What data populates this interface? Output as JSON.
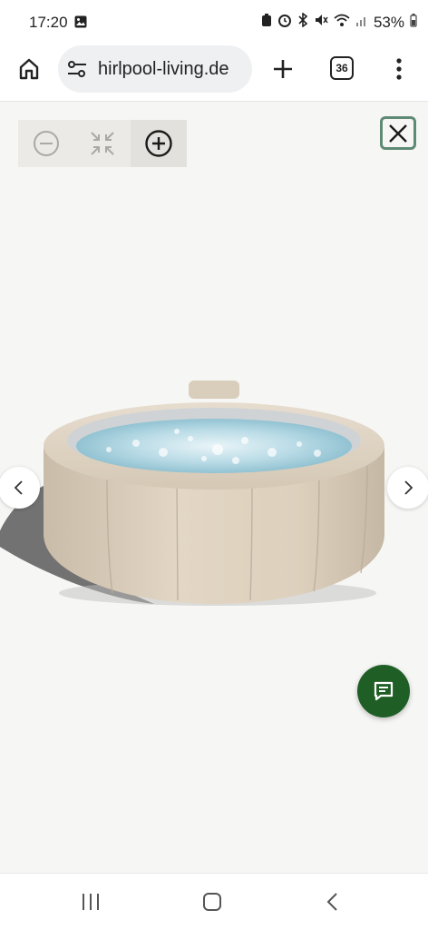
{
  "status_bar": {
    "time": "17:20",
    "battery": "53%"
  },
  "browser": {
    "url": "hirlpool-living.de",
    "tab_count": "36"
  },
  "viewer": {
    "zoom_out_icon": "minus-circle-icon",
    "fit_icon": "collapse-arrows-icon",
    "zoom_in_icon": "plus-circle-icon",
    "close_icon": "close-icon",
    "prev_icon": "chevron-left-icon",
    "next_icon": "chevron-right-icon"
  },
  "chat": {
    "icon": "chat-bubble-icon",
    "color": "#1f5f26"
  },
  "colors": {
    "accent_close_border": "#5f8a74",
    "background": "#f6f6f4"
  }
}
